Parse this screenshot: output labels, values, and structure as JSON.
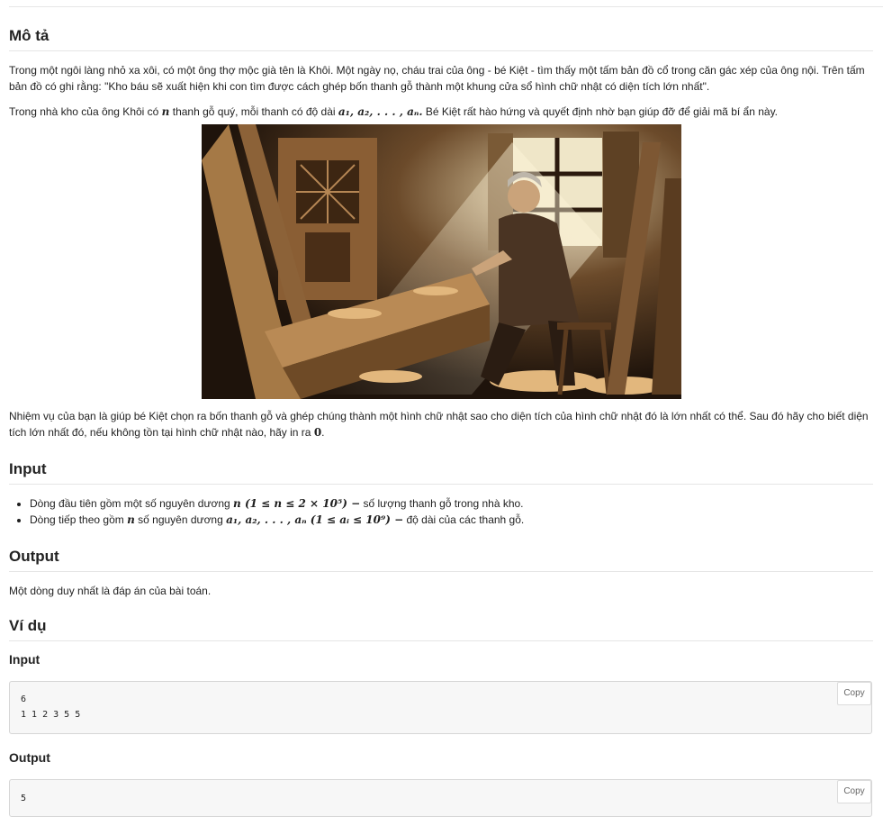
{
  "sections": {
    "description": {
      "heading": "Mô tả",
      "p1": "Trong một ngôi làng nhỏ xa xôi, có một ông thợ mộc già tên là Khôi. Một ngày nọ, cháu trai của ông - bé Kiệt - tìm thấy một tấm bản đồ cổ trong căn gác xép của ông nội. Trên tấm bản đồ có ghi rằng: \"Kho báu sẽ xuất hiện khi con tìm được cách ghép bốn thanh gỗ thành một khung cửa sổ hình chữ nhật có diện tích lớn nhất\".",
      "p2_a": "Trong nhà kho của ông Khôi có ",
      "p2_n": "n",
      "p2_b": " thanh gỗ quý, mỗi thanh có độ dài ",
      "p2_seq": "a₁, a₂, . . . , aₙ.",
      "p2_c": " Bé Kiệt rất hào hứng và quyết định nhờ bạn giúp đỡ để giải mã bí ẩn này.",
      "p3_a": "Nhiệm vụ của bạn là giúp bé Kiệt chọn ra bốn thanh gỗ và ghép chúng thành một hình chữ nhật sao cho diện tích của hình chữ nhật đó là lớn nhất có thể. Sau đó hãy cho biết diện tích lớn nhất đó, nếu không tồn tại hình chữ nhật nào, hãy in ra ",
      "p3_zero": "0",
      "p3_b": "."
    },
    "input": {
      "heading": "Input",
      "item1_a": "Dòng đầu tiên gồm một số nguyên dương ",
      "item1_math": "n (1 ≤ n ≤ 2 × 10⁵) −",
      "item1_b": " số lượng thanh gỗ trong nhà kho.",
      "item2_a": "Dòng tiếp theo gồm ",
      "item2_n": "n",
      "item2_b": " số nguyên dương ",
      "item2_math": "a₁, a₂, . . . , aₙ (1 ≤ aᵢ ≤ 10⁹) −",
      "item2_c": " độ dài của các thanh gỗ."
    },
    "output": {
      "heading": "Output",
      "text": "Một dòng duy nhất là đáp án của bài toán."
    },
    "example": {
      "heading": "Ví dụ",
      "input_label": "Input",
      "input_code": "6\n1 1 2 3 5 5",
      "output_label": "Output",
      "output_code": "5",
      "copy_label": "Copy"
    }
  },
  "colors": {
    "code_bg": "#f7f7f7",
    "rule": "#e5e5e5"
  }
}
